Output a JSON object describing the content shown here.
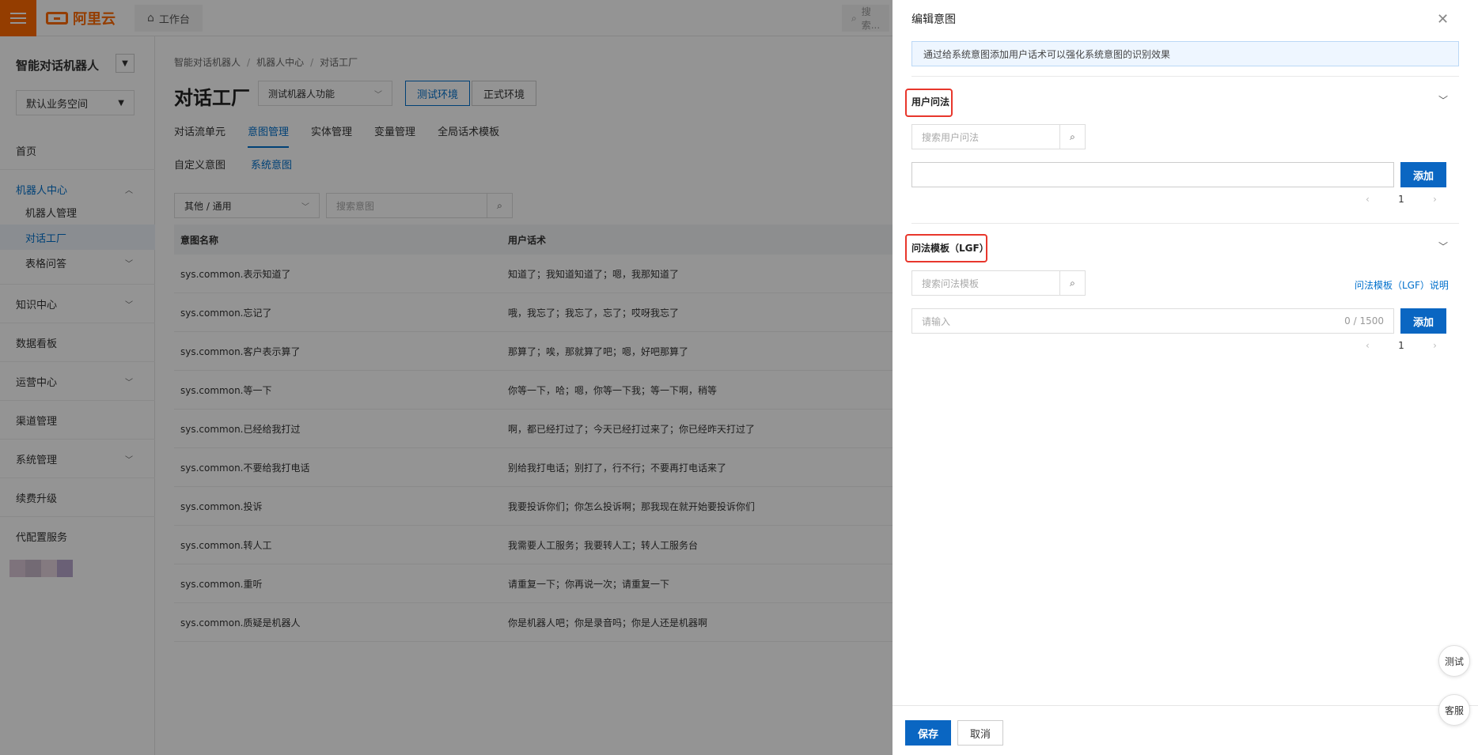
{
  "topbar": {
    "logo": "阿里云",
    "workbench": "工作台",
    "search_placeholder": "搜索..."
  },
  "sidebar": {
    "title": "智能对话机器人",
    "space": "默认业务空间",
    "items": [
      {
        "label": "首页"
      },
      {
        "label": "机器人中心"
      },
      {
        "label": "机器人管理"
      },
      {
        "label": "对话工厂"
      },
      {
        "label": "表格问答"
      },
      {
        "label": "知识中心"
      },
      {
        "label": "数据看板"
      },
      {
        "label": "运营中心"
      },
      {
        "label": "渠道管理"
      },
      {
        "label": "系统管理"
      },
      {
        "label": "续费升级"
      },
      {
        "label": "代配置服务"
      }
    ]
  },
  "main": {
    "breadcrumb": [
      "智能对话机器人",
      "机器人中心",
      "对话工厂"
    ],
    "title": "对话工厂",
    "bot_select": "测试机器人功能",
    "env_test": "测试环境",
    "env_prod": "正式环境",
    "tabs": [
      "对话流单元",
      "意图管理",
      "实体管理",
      "变量管理",
      "全局话术模板"
    ],
    "subtabs": [
      "自定义意图",
      "系统意图"
    ],
    "category": "其他 / 通用",
    "search_placeholder": "搜索意图",
    "columns": [
      "意图名称",
      "用户话术"
    ],
    "rows": [
      {
        "name": "sys.common.表示知道了",
        "utter": "知道了；我知道知道了；嗯，我那知道了"
      },
      {
        "name": "sys.common.忘记了",
        "utter": "哦，我忘了；我忘了，忘了；哎呀我忘了"
      },
      {
        "name": "sys.common.客户表示算了",
        "utter": "那算了；唉，那就算了吧；嗯，好吧那算了"
      },
      {
        "name": "sys.common.等一下",
        "utter": "你等一下，哈；嗯，你等一下我；等一下啊，稍等"
      },
      {
        "name": "sys.common.已经给我打过",
        "utter": "啊，都已经打过了；今天已经打过来了；你已经昨天打过了"
      },
      {
        "name": "sys.common.不要给我打电话",
        "utter": "别给我打电话；别打了，行不行；不要再打电话来了"
      },
      {
        "name": "sys.common.投诉",
        "utter": "我要投诉你们；你怎么投诉啊；那我现在就开始要投诉你们"
      },
      {
        "name": "sys.common.转人工",
        "utter": "我需要人工服务；我要转人工；转人工服务台"
      },
      {
        "name": "sys.common.重听",
        "utter": "请重复一下；你再说一次；请重复一下"
      },
      {
        "name": "sys.common.质疑是机器人",
        "utter": "你是机器人吧；你是录音吗；你是人还是机器啊"
      }
    ]
  },
  "drawer": {
    "title": "编辑意图",
    "tip": "通过给系统意图添加用户话术可以强化系统意图的识别效果",
    "user_section": "用户问法",
    "user_search_placeholder": "搜索用户问法",
    "add_label": "添加",
    "page": "1",
    "lgf_section": "问法模板（LGF）",
    "lgf_search_placeholder": "搜索问法模板",
    "lgf_link": "问法模板（LGF）说明",
    "lgf_input_placeholder": "请输入",
    "lgf_counter": "0 / 1500",
    "save": "保存",
    "cancel": "取消"
  },
  "floating": {
    "test": "测试",
    "service": "客服"
  },
  "colors": {
    "brand": "#ff6a00",
    "accent": "#0a66c2",
    "highlight": "#e8372c"
  }
}
